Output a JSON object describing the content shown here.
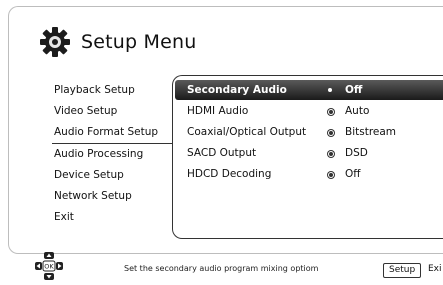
{
  "header": {
    "title": "Setup Menu",
    "icon": "gear-icon"
  },
  "left_menu": [
    {
      "label": "Playback Setup"
    },
    {
      "label": "Video Setup"
    },
    {
      "label": "Audio Format Setup",
      "active": true
    },
    {
      "label": "Audio Processing"
    },
    {
      "label": "Device Setup"
    },
    {
      "label": "Network Setup"
    },
    {
      "label": "Exit"
    }
  ],
  "options": [
    {
      "label": "Secondary Audio",
      "value": "Off",
      "selected": true
    },
    {
      "label": "HDMI Audio",
      "value": "Auto"
    },
    {
      "label": "Coaxial/Optical Output",
      "value": "Bitstream"
    },
    {
      "label": "SACD Output",
      "value": "DSD"
    },
    {
      "label": "HDCD Decoding",
      "value": "Off"
    }
  ],
  "footer": {
    "hint": "Set the secondary audio program mixing optiom",
    "setup_button": "Setup",
    "exit_label": "Exi",
    "dpad_ok": "OK"
  },
  "colors": {
    "selection": "#2b2b2b",
    "border": "#333333"
  }
}
